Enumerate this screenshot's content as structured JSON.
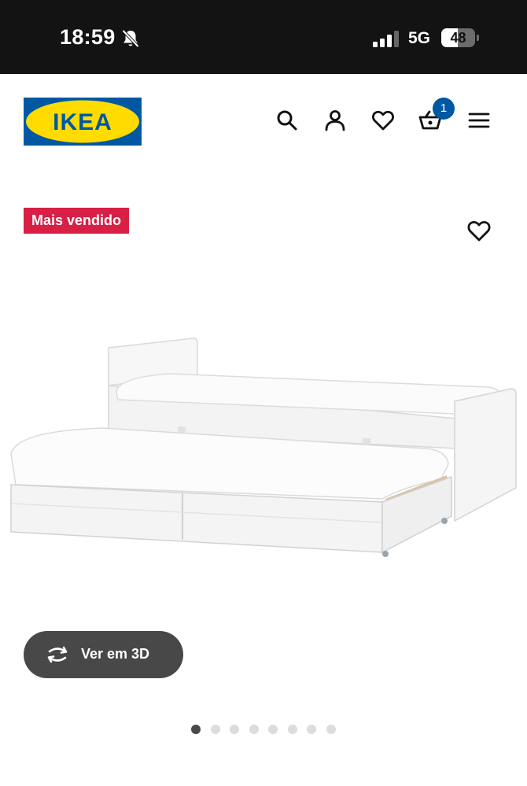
{
  "status_bar": {
    "time": "18:59",
    "bell_icon": "bell-slash-icon",
    "signal_icon": "cellular-signal-icon",
    "network": "5G",
    "battery_percent": 48,
    "battery_label": "48"
  },
  "header": {
    "logo_text": "IKEA",
    "logo_colors": {
      "blue": "#0058a3",
      "yellow": "#ffdb00"
    },
    "icons": [
      "search-icon",
      "account-icon",
      "heart-icon",
      "basket-icon",
      "menu-icon"
    ],
    "cart_count": "1"
  },
  "product": {
    "badge": "Mais vendido",
    "badge_color": "#d81f45",
    "favourite_icon": "heart-icon",
    "image_subject": "white daybed with pull-out bed and drawers",
    "view_3d_label": "Ver em 3D",
    "view_3d_icon": "rotate-3d-icon"
  },
  "gallery": {
    "image_count": 8,
    "active_index": 0
  }
}
